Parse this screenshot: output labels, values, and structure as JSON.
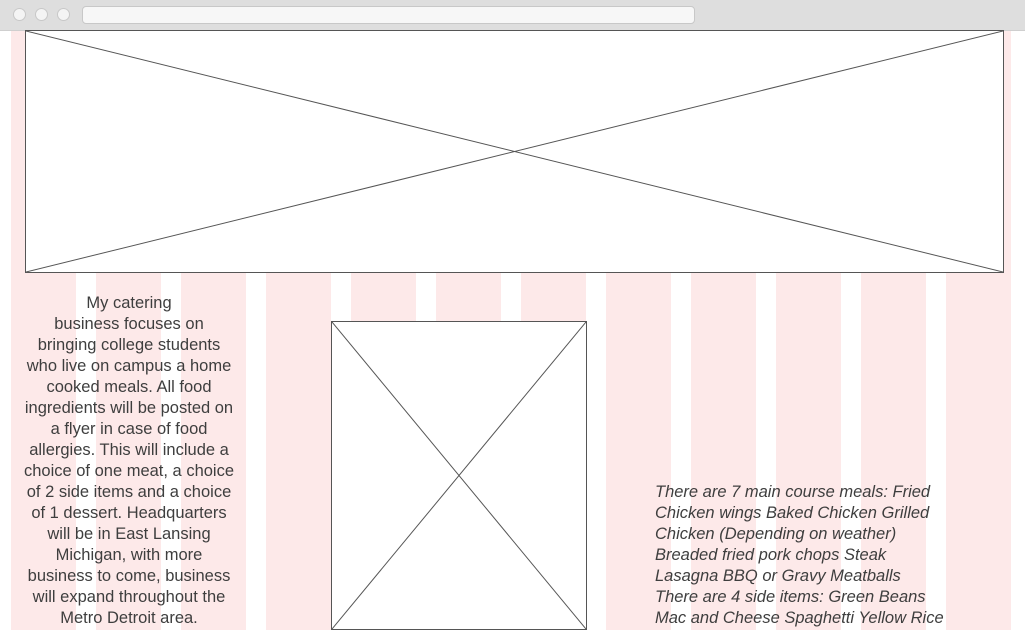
{
  "browser": {
    "window_controls": [
      "close-control",
      "minimize-control",
      "maximize-control"
    ],
    "address_bar_value": ""
  },
  "header_image": {
    "icon": "image-placeholder-icon"
  },
  "side_image": {
    "icon": "image-placeholder-icon"
  },
  "intro": {
    "text": "My catering\nbusiness focuses on\nbringing college students\nwho live on campus a home\ncooked meals. All food\ningredients will be posted on\na flyer in case of food\nallergies. This will include a\nchoice of one meat, a choice\nof 2 side items and a choice\nof 1 dessert. Headquarters\nwill be in East Lansing\nMichigan, with more\nbusiness to come, business\nwill expand throughout the\nMetro Detroit area."
  },
  "menu": {
    "text": "There are 7 main course meals: Fried\nChicken wings Baked Chicken Grilled\nChicken (Depending on weather)\nBreaded fried pork chops Steak\nLasagna BBQ or Gravy Meatballs\nThere are 4 side items: Green Beans\nMac and Cheese Spaghetti Yellow Rice"
  },
  "colors": {
    "grid_column": "#fde9e9",
    "chrome": "#dedede",
    "text": "#3e3e3e",
    "placeholder_stroke": "#555555"
  }
}
